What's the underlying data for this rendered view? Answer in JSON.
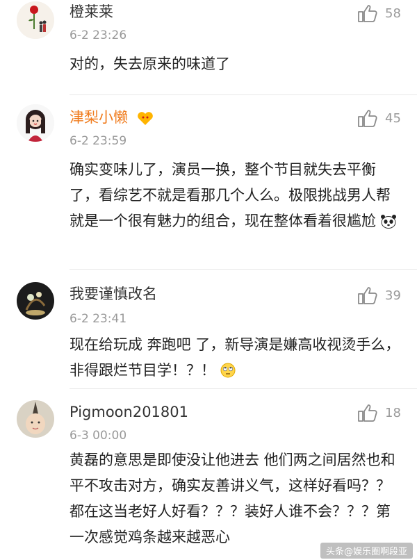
{
  "comments": [
    {
      "user": "橙莱莱",
      "time": "6-2 23:26",
      "likes": "58",
      "text": "对的，失去原来的味道了",
      "avatar": "rose-avatar"
    },
    {
      "user": "津梨小懒",
      "time": "6-2 23:59",
      "likes": "45",
      "text": "确实变味儿了，演员一换，整个节目就失去平衡了，看综艺不就是看那几个人么。极限挑战男人帮就是一个很有魅力的组合，现在整体看着很尴尬",
      "avatar": "cartoon-girl-avatar",
      "badge": "vip-heart-badge",
      "emoji": "panda-emoji"
    },
    {
      "user": "我要谨慎改名",
      "time": "6-2 23:41",
      "likes": "39",
      "text": "现在给玩成 奔跑吧 了，新导演是嫌高收视烫手么，非得跟烂节目学！？！",
      "avatar": "bonsai-avatar",
      "emoji": "rolling-eyes-emoji"
    },
    {
      "user": "Pigmoon201801",
      "time": "6-3 00:00",
      "likes": "18",
      "text": "黄磊的意思是即使没让他进去 他们两之间居然也和平不攻击对方，确实友善讲义气，这样好看吗？？都在这当老好人好看？？？装好人谁不会？？？第一次感觉鸡条越来越恶心",
      "avatar": "child-avatar"
    }
  ],
  "colors": {
    "username": "#333333",
    "vip_username": "#f07c1e",
    "meta": "#999999",
    "divider": "#e8e8e8"
  },
  "icons": {
    "like": "thumbs-up-icon"
  },
  "watermark": "头条@娱乐圈啊段亚"
}
